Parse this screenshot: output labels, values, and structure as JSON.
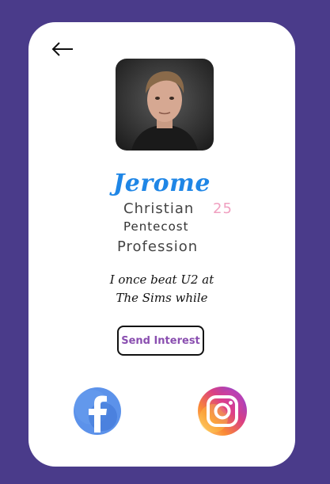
{
  "profile": {
    "name": "Jerome",
    "religion": "Christian",
    "age": "25",
    "denomination": "Pentecost",
    "profession": "Profession",
    "bio_line1": "I once beat U2 at",
    "bio_line2": "The Sims while"
  },
  "actions": {
    "send_interest_label": "Send Interest"
  },
  "icons": {
    "back": "back-arrow-icon",
    "facebook": "facebook-icon",
    "instagram": "instagram-icon"
  },
  "colors": {
    "background": "#4a3b8a",
    "name": "#1f86e6",
    "age": "#f0a0c0",
    "send_interest": "#8a4fb0",
    "facebook": "#1877f2",
    "instagram_gradient": [
      "#feda75",
      "#fa7e1e",
      "#d62976",
      "#962fbf",
      "#4f5bd5"
    ]
  }
}
